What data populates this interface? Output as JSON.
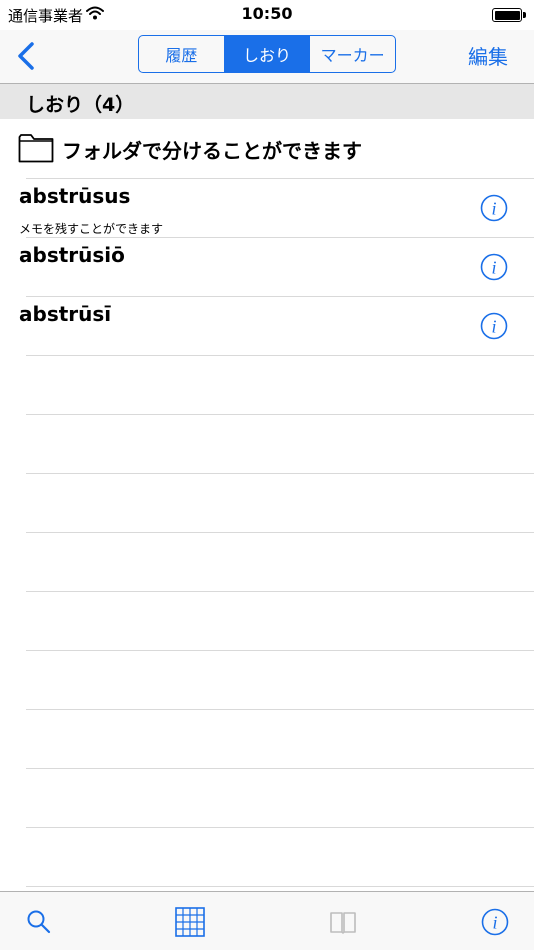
{
  "status_bar": {
    "carrier": "通信事業者",
    "time": "10:50"
  },
  "nav": {
    "segments": [
      "履歴",
      "しおり",
      "マーカー"
    ],
    "selected_segment": "しおり",
    "edit_label": "編集"
  },
  "section": {
    "title": "しおり（4）"
  },
  "folder": {
    "label": "フォルダで分けることができます"
  },
  "items": [
    {
      "title": "abstrūsus",
      "note": "メモを残すことができます"
    },
    {
      "title": "abstrūsiō",
      "note": ""
    },
    {
      "title": "abstrūsī",
      "note": ""
    }
  ],
  "colors": {
    "accent": "#1a6fe8",
    "header_bg": "#e6e6e6",
    "separator": "#d9d9d9"
  },
  "tab_bar": {
    "tabs": [
      "search-icon",
      "grid-icon",
      "book-icon",
      "info-icon"
    ],
    "disabled": [
      "book-icon"
    ]
  }
}
